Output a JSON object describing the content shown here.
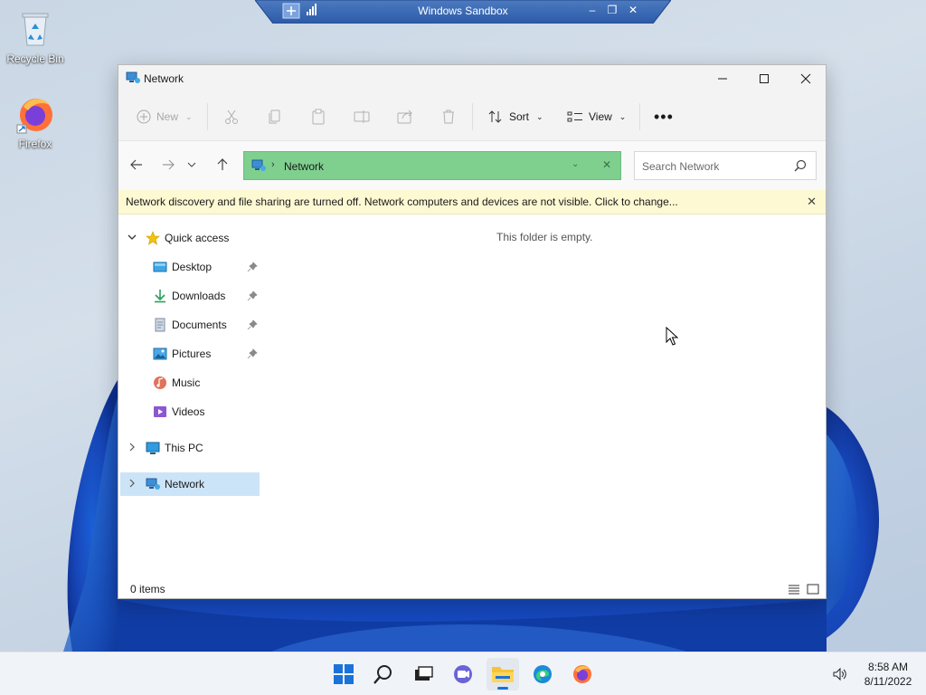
{
  "sandbox": {
    "title": "Windows Sandbox"
  },
  "desktop": {
    "icons": [
      {
        "label": "Recycle Bin"
      },
      {
        "label": "Firefox"
      }
    ]
  },
  "explorer": {
    "title": "Network",
    "commands": {
      "new_label": "New",
      "sort_label": "Sort",
      "view_label": "View"
    },
    "address": {
      "location": "Network"
    },
    "search": {
      "placeholder": "Search Network"
    },
    "infobar": {
      "message": "Network discovery and file sharing are turned off. Network computers and devices are not visible. Click to change..."
    },
    "sidebar": {
      "quick_access": "Quick access",
      "items": [
        {
          "label": "Desktop"
        },
        {
          "label": "Downloads"
        },
        {
          "label": "Documents"
        },
        {
          "label": "Pictures"
        },
        {
          "label": "Music"
        },
        {
          "label": "Videos"
        }
      ],
      "this_pc": "This PC",
      "network": "Network"
    },
    "content": {
      "empty_message": "This folder is empty."
    },
    "status": {
      "item_count": "0 items"
    }
  },
  "taskbar": {
    "time": "8:58 AM",
    "date": "8/11/2022"
  },
  "colors": {
    "accent": "#1a73d9",
    "address_bar": "#7fcf8f",
    "infobar": "#fdf9d3",
    "selection": "#cce4f7"
  }
}
